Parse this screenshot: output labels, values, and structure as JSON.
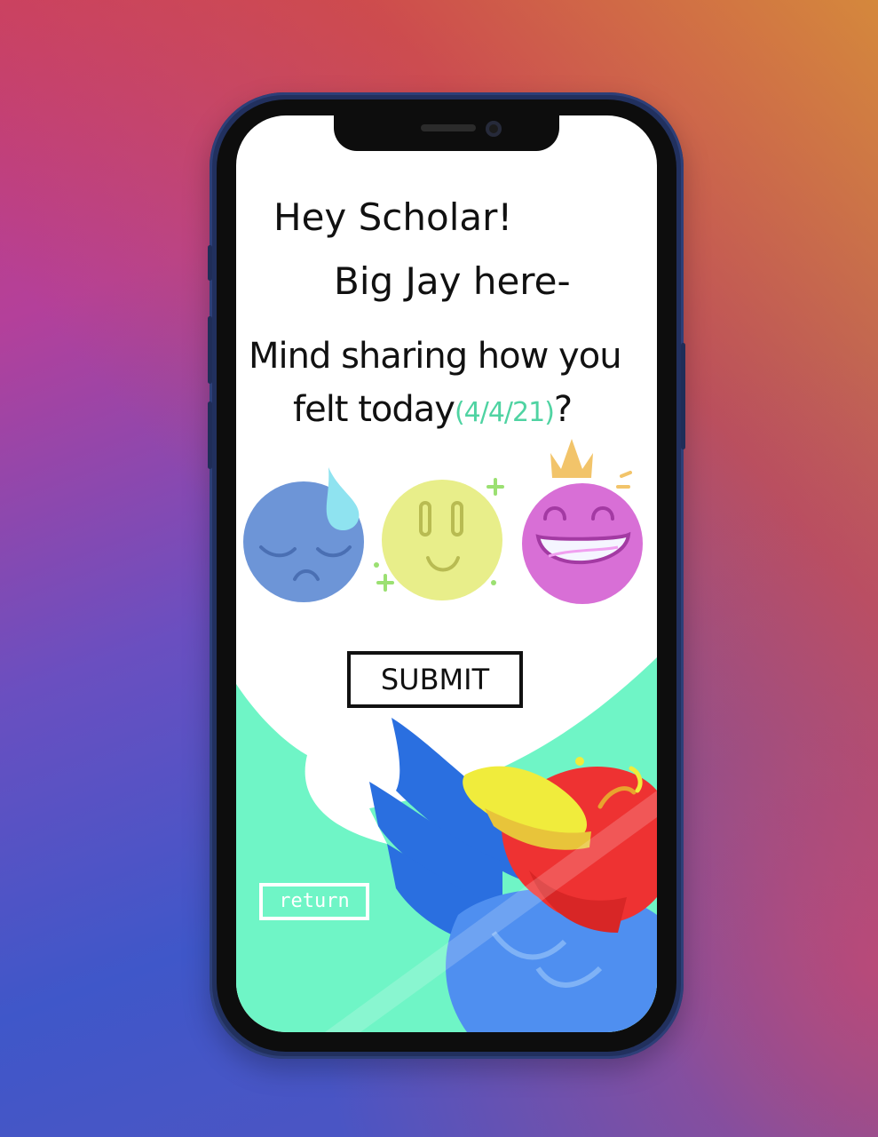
{
  "prompt": {
    "greeting_line1": "Hey Scholar!",
    "greeting_line2": "Big Jay here-",
    "question_line1": "Mind sharing how you",
    "question_line2_prefix": "felt today",
    "date": "(4/4/21)",
    "question_mark": "?"
  },
  "moods": [
    {
      "name": "sad",
      "color": "#6d95d7"
    },
    {
      "name": "okay",
      "color": "#e8ee8a"
    },
    {
      "name": "happy",
      "color": "#d86fd6"
    }
  ],
  "buttons": {
    "submit_label": "SUBMIT",
    "return_label": "return"
  },
  "colors": {
    "accent_green": "#6ff5c6",
    "date_green": "#4fd3a2",
    "mascot_blue": "#2a6fe0",
    "mascot_red": "#ee3232",
    "beak_yellow": "#f0ec3c"
  }
}
